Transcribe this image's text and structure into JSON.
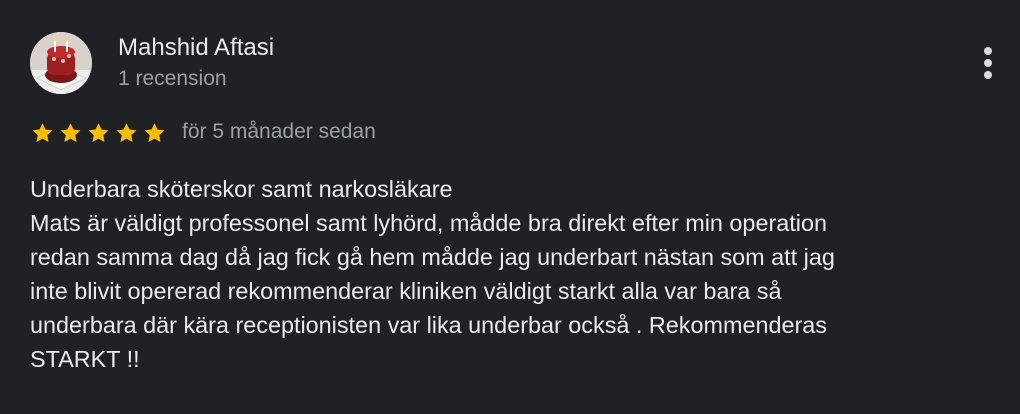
{
  "review": {
    "author": {
      "name": "Mahshid Aftasi",
      "review_count": "1 recension",
      "avatar": "profile-photo"
    },
    "menu_icon": "more-vert-icon",
    "rating": {
      "stars": 5,
      "max": 5,
      "star_color": "#fbbc04"
    },
    "date": "för 5 månader sedan",
    "text_lines": [
      "Underbara sköterskor samt narkosläkare",
      "Mats är väldigt professonel samt lyhörd, mådde bra direkt efter min operation",
      "redan samma dag då jag fick gå hem mådde jag underbart nästan som att jag",
      "inte blivit opererad rekommenderar kliniken väldigt starkt alla var bara så",
      "underbara där kära receptionisten var lika underbar också . Rekommenderas",
      "STARKT !!"
    ]
  },
  "colors": {
    "background": "#202124",
    "primary_text": "#e8eaed",
    "secondary_text": "#9aa0a6",
    "star": "#fbbc04"
  }
}
